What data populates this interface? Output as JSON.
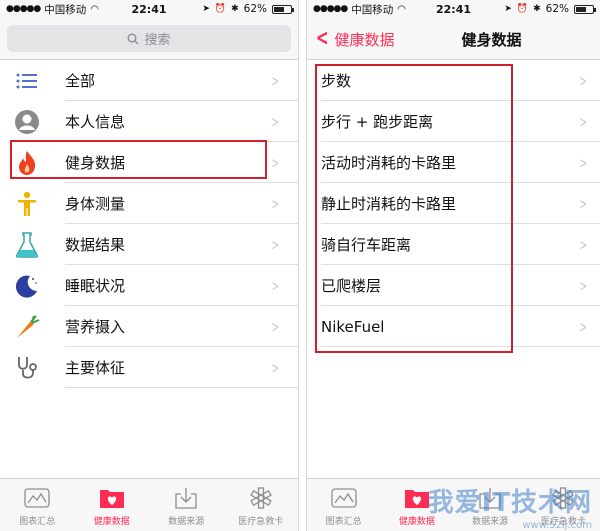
{
  "status_bar": {
    "carrier": "中国移动",
    "time": "22:41",
    "battery": "62%",
    "battery_level": 0.62
  },
  "left": {
    "search_placeholder": "搜索",
    "items": [
      {
        "label": "全部",
        "icon": "list-icon"
      },
      {
        "label": "本人信息",
        "icon": "person-icon"
      },
      {
        "label": "健身数据",
        "icon": "flame-icon"
      },
      {
        "label": "身体测量",
        "icon": "body-figure-icon"
      },
      {
        "label": "数据结果",
        "icon": "flask-icon"
      },
      {
        "label": "睡眠状况",
        "icon": "moon-icon"
      },
      {
        "label": "营养摄入",
        "icon": "carrot-icon"
      },
      {
        "label": "主要体征",
        "icon": "stethoscope-icon"
      }
    ]
  },
  "right": {
    "back_label": "健康数据",
    "title": "健身数据",
    "items": [
      {
        "label": "步数"
      },
      {
        "label": "步行 + 跑步距离"
      },
      {
        "label": "活动时消耗的卡路里"
      },
      {
        "label": "静止时消耗的卡路里"
      },
      {
        "label": "骑自行车距离"
      },
      {
        "label": "已爬楼层"
      },
      {
        "label": "NikeFuel"
      }
    ]
  },
  "tabbar": {
    "tabs": [
      {
        "label": "图表汇总",
        "icon": "chart-icon"
      },
      {
        "label": "健康数据",
        "icon": "health-folder-icon",
        "active": true
      },
      {
        "label": "数据来源",
        "icon": "download-icon"
      },
      {
        "label": "医疗急救卡",
        "icon": "medical-star-icon"
      }
    ]
  },
  "watermark": {
    "text": "我爱IT技术网",
    "sub": "www.52ij.com"
  },
  "colors": {
    "accent": "#ff2d55",
    "highlight": "#d0202c",
    "inactive": "#8e8e93"
  }
}
